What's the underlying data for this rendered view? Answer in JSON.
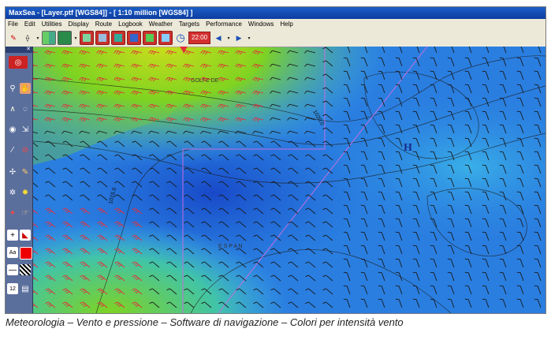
{
  "window": {
    "title": "MaxSea - [Layer.ptf [WGS84]] - [ 1:10 million [WGS84] ]"
  },
  "menu": {
    "items": [
      "File",
      "Edit",
      "Utilities",
      "Display",
      "Route",
      "Logbook",
      "Weather",
      "Targets",
      "Performance",
      "Windows",
      "Help"
    ]
  },
  "toolbar": {
    "time_label": "22:00",
    "icons": [
      "pencil-icon",
      "compass-icon",
      "grid-icon",
      "globe-icon",
      "layers-icon",
      "chart-icon",
      "weather-icon",
      "gauge-icon",
      "satellite-icon",
      "clock-icon",
      "arrow-left-icon",
      "arrow-right-icon"
    ]
  },
  "sidebar": {
    "close_label": "✕",
    "tools": [
      "lifebuoy-icon",
      "zoom-in-icon",
      "hand-icon",
      "route-icon",
      "measure-icon",
      "mark-icon",
      "target-icon",
      "text-icon",
      "color-icon",
      "line-icon",
      "pattern-icon",
      "layer-icon"
    ]
  },
  "map": {
    "high_pressure_label": "H",
    "isobar_labels": [
      "1020.0",
      "1015.0"
    ],
    "region_labels": [
      "GOLFE DE",
      "E S P A N"
    ],
    "colors": {
      "low_wind": "#1e66d6",
      "mid_wind": "#41b4e8",
      "high_wind": "#7ed321",
      "very_high_wind": "#f0e020",
      "isobar": "#1a1a1a",
      "route": "#c070e0",
      "wind_barbs": "#e0303a"
    }
  },
  "caption": {
    "text": "Meteorologia – Vento e pressione – Software di navigazione – Colori per intensità vento"
  }
}
